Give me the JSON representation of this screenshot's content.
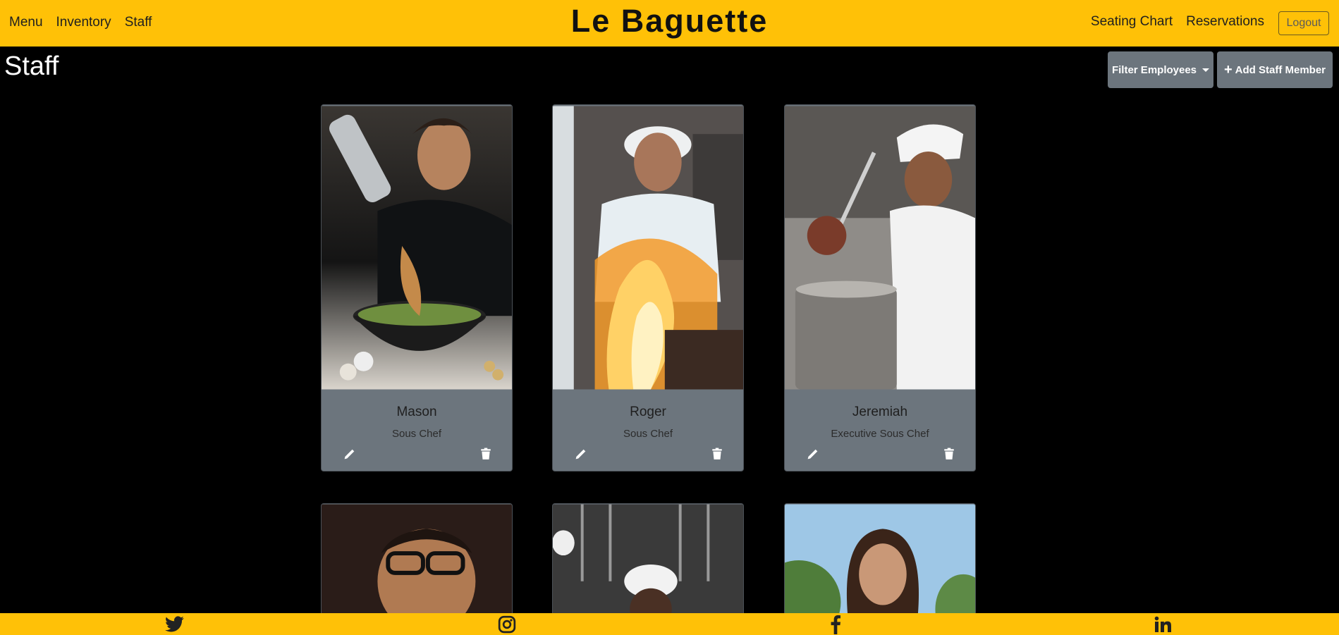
{
  "nav": {
    "links": [
      "Menu",
      "Inventory",
      "Staff"
    ],
    "brand": "Le Baguette",
    "right_links": [
      "Seating Chart",
      "Reservations"
    ],
    "logout": "Logout"
  },
  "page": {
    "title": "Staff",
    "filter_label": "Filter Employees",
    "add_label": "Add Staff Member"
  },
  "staff": [
    {
      "name": "Mason",
      "role": "Sous Chef"
    },
    {
      "name": "Roger",
      "role": "Sous Chef"
    },
    {
      "name": "Jeremiah",
      "role": "Executive Sous Chef"
    }
  ],
  "footer": {
    "icons": [
      "twitter-icon",
      "instagram-icon",
      "facebook-icon",
      "linkedin-icon"
    ]
  },
  "colors": {
    "accent": "#ffc107",
    "card": "#6c757d",
    "background": "#000000"
  }
}
